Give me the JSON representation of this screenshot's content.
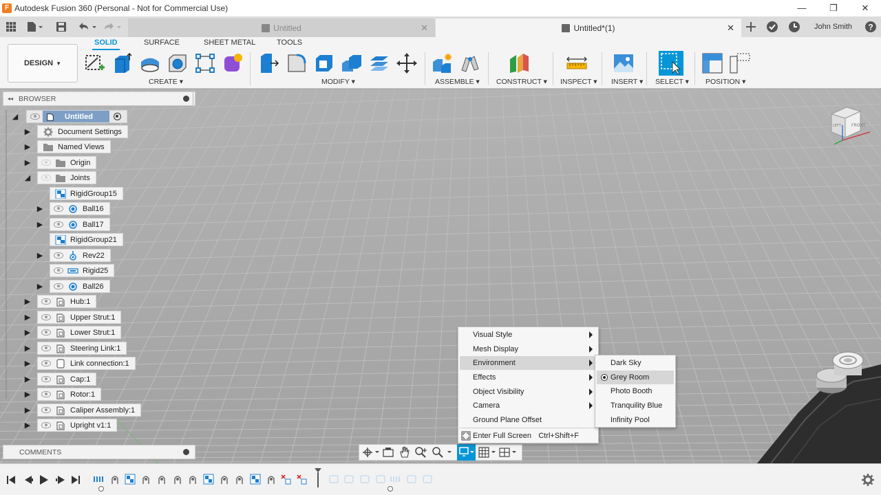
{
  "window": {
    "title": "Autodesk Fusion 360 (Personal - Not for Commercial Use)",
    "minimize": "—",
    "restore": "❐",
    "close": "✕"
  },
  "tabs": {
    "inactive_label": "Untitled",
    "active_label": "Untitled*(1)",
    "close_glyph": "✕",
    "user_name": "John Smith"
  },
  "toolbar": {
    "workspace": "DESIGN",
    "workspace_tabs": [
      "SOLID",
      "SURFACE",
      "SHEET METAL",
      "TOOLS"
    ],
    "groups": [
      "CREATE",
      "MODIFY",
      "ASSEMBLE",
      "CONSTRUCT",
      "INSPECT",
      "INSERT",
      "SELECT",
      "POSITION"
    ]
  },
  "browser": {
    "title": "BROWSER",
    "root": "Untitled",
    "items": [
      {
        "label": "Document Settings"
      },
      {
        "label": "Named Views"
      },
      {
        "label": "Origin"
      },
      {
        "label": "Joints"
      },
      {
        "label": "RigidGroup15"
      },
      {
        "label": "Ball16"
      },
      {
        "label": "Ball17"
      },
      {
        "label": "RigidGroup21"
      },
      {
        "label": "Rev22"
      },
      {
        "label": "Rigid25"
      },
      {
        "label": "Ball26"
      },
      {
        "label": "Hub:1"
      },
      {
        "label": "Upper Strut:1"
      },
      {
        "label": "Lower Strut:1"
      },
      {
        "label": "Steering Link:1"
      },
      {
        "label": "Link connection:1"
      },
      {
        "label": "Cap:1"
      },
      {
        "label": "Rotor:1"
      },
      {
        "label": "Caliper Assembly:1"
      },
      {
        "label": "Upright v1:1"
      }
    ]
  },
  "comments": {
    "title": "COMMENTS"
  },
  "display_menu": {
    "items": [
      {
        "label": "Visual Style"
      },
      {
        "label": "Mesh Display"
      },
      {
        "label": "Environment"
      },
      {
        "label": "Effects"
      },
      {
        "label": "Object Visibility"
      },
      {
        "label": "Camera"
      },
      {
        "label": "Ground Plane Offset"
      }
    ],
    "fullscreen_label": "Enter Full Screen",
    "fullscreen_shortcut": "Ctrl+Shift+F"
  },
  "environment_menu": {
    "items": [
      {
        "label": "Dark Sky"
      },
      {
        "label": "Grey Room"
      },
      {
        "label": "Photo Booth"
      },
      {
        "label": "Tranquility Blue"
      },
      {
        "label": "Infinity Pool"
      }
    ],
    "selected": "Grey Room"
  },
  "viewcube": {
    "front": "FRONT",
    "left": "LEFT"
  },
  "colors": {
    "accent": "#0696d7",
    "viewport": "#a9a9a9",
    "panel": "#f2f2f2"
  }
}
